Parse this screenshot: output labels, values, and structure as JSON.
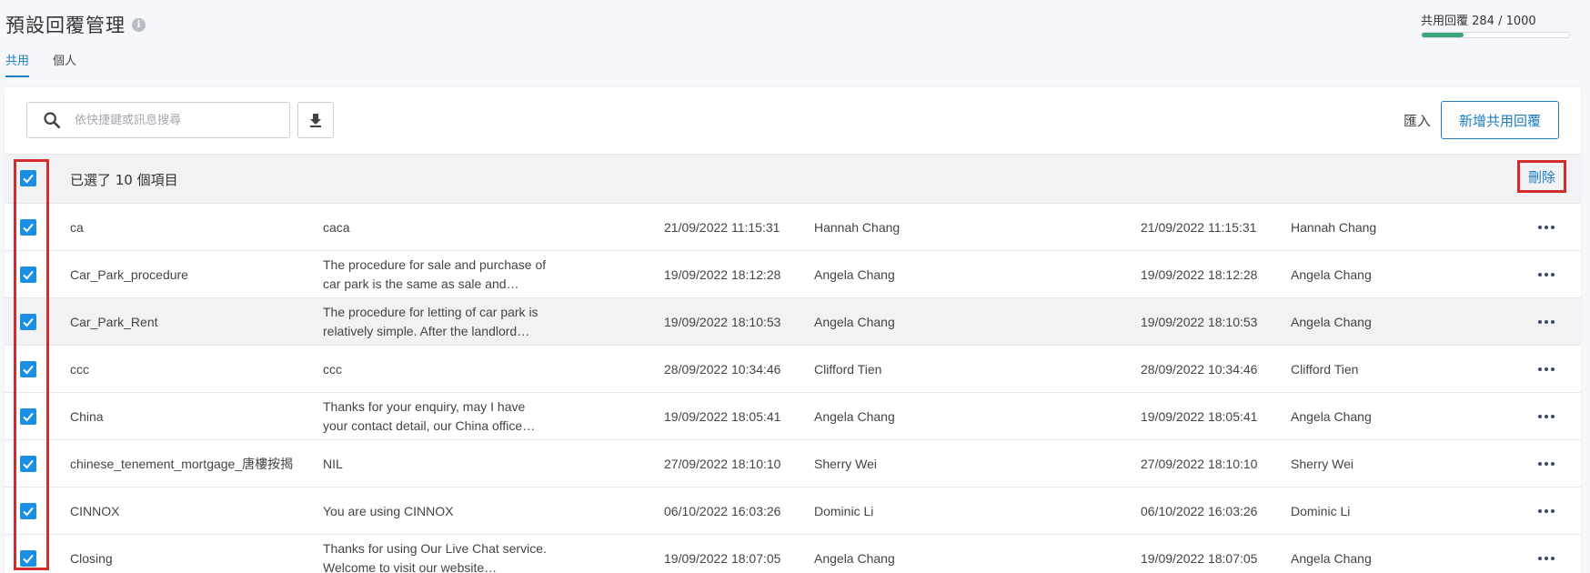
{
  "page": {
    "title": "預設回覆管理",
    "info_icon": "info-icon",
    "quota_label": "共用回覆 284 / 1000",
    "quota_fraction": 0.284
  },
  "tabs": [
    {
      "label": "共用",
      "active": true
    },
    {
      "label": "個人",
      "active": false
    }
  ],
  "toolbar": {
    "search_placeholder": "依快捷鍵或訊息搜尋",
    "search_icon": "search-icon",
    "download_icon": "download-icon",
    "import_label": "匯入",
    "add_label": "新增共用回覆"
  },
  "bulk": {
    "selected_text": "已選了 10 個項目",
    "delete_label": "刪除"
  },
  "colors": {
    "accent": "#1c7dc2",
    "checkbox": "#1a8fe3",
    "highlight": "#d42c2c",
    "quota": "#3aa57a"
  },
  "rows": [
    {
      "key": "ca",
      "message": "caca",
      "created_at": "21/09/2022 11:15:31",
      "created_by": "Hannah Chang",
      "modified_at": "21/09/2022 11:15:31",
      "modified_by": "Hannah Chang"
    },
    {
      "key": "Car_Park_procedure",
      "message": "The procedure for sale and purchase of car park is the same as sale and…",
      "created_at": "19/09/2022 18:12:28",
      "created_by": "Angela Chang",
      "modified_at": "19/09/2022 18:12:28",
      "modified_by": "Angela Chang"
    },
    {
      "key": "Car_Park_Rent",
      "message": "The procedure for letting of car park is relatively simple. After the landlord…",
      "created_at": "19/09/2022 18:10:53",
      "created_by": "Angela Chang",
      "modified_at": "19/09/2022 18:10:53",
      "modified_by": "Angela Chang"
    },
    {
      "key": "ccc",
      "message": "ccc",
      "created_at": "28/09/2022 10:34:46",
      "created_by": "Clifford Tien",
      "modified_at": "28/09/2022 10:34:46",
      "modified_by": "Clifford Tien"
    },
    {
      "key": "China",
      "message": "Thanks for your enquiry, may I have your contact detail, our China office…",
      "created_at": "19/09/2022 18:05:41",
      "created_by": "Angela Chang",
      "modified_at": "19/09/2022 18:05:41",
      "modified_by": "Angela Chang"
    },
    {
      "key": "chinese_tenement_mortgage_唐樓按揭",
      "message": "NIL",
      "created_at": "27/09/2022 18:10:10",
      "created_by": "Sherry Wei",
      "modified_at": "27/09/2022 18:10:10",
      "modified_by": "Sherry Wei"
    },
    {
      "key": "CINNOX",
      "message": "You are using CINNOX",
      "created_at": "06/10/2022 16:03:26",
      "created_by": "Dominic Li",
      "modified_at": "06/10/2022 16:03:26",
      "modified_by": "Dominic Li"
    },
    {
      "key": "Closing",
      "message": "Thanks for using Our Live Chat service. Welcome to visit our website…",
      "created_at": "19/09/2022 18:07:05",
      "created_by": "Angela Chang",
      "modified_at": "19/09/2022 18:07:05",
      "modified_by": "Angela Chang"
    }
  ]
}
